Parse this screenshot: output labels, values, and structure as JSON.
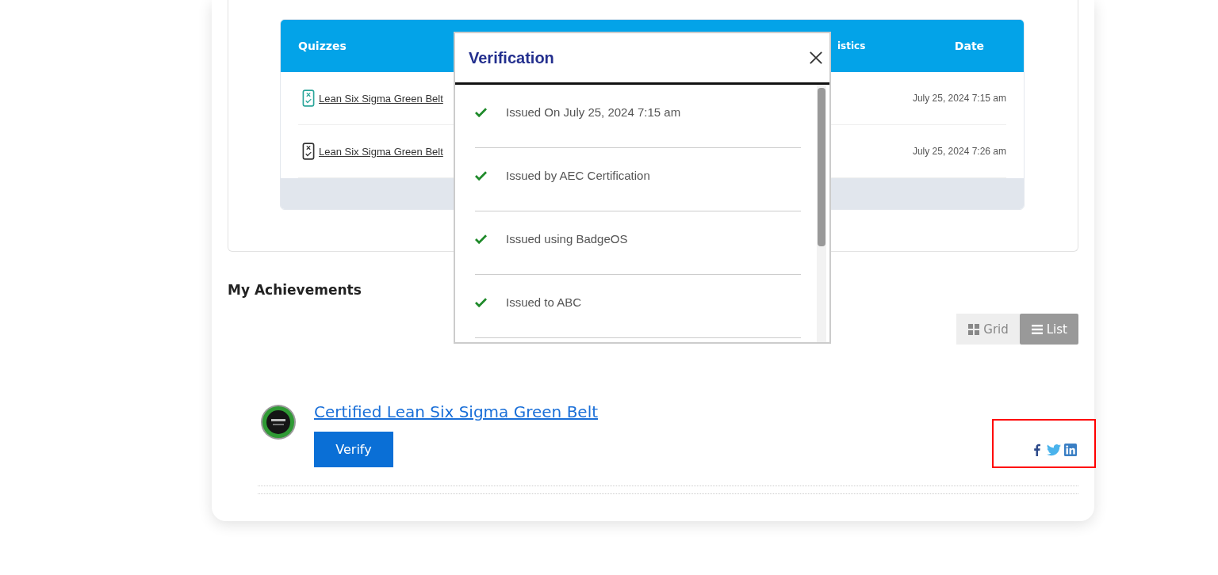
{
  "quiz_table": {
    "columns": [
      "Quizzes",
      "istics",
      "Date"
    ],
    "rows": [
      {
        "quiz": "Lean Six Sigma Green Belt",
        "date": "July 25, 2024 7:15 am",
        "kind": "passed"
      },
      {
        "quiz": "Lean Six Sigma Green Belt",
        "date": "July 25, 2024 7:26 am",
        "kind": "failed"
      }
    ]
  },
  "achievements": {
    "heading": "My Achievements",
    "views": [
      {
        "label": "Grid",
        "kind": "grid",
        "selected": false
      },
      {
        "label": "List",
        "kind": "list",
        "selected": true
      }
    ],
    "items": [
      {
        "title": "Certified Lean Six Sigma Green Belt",
        "button": "Verify"
      }
    ]
  },
  "verification_dialog": {
    "title": "Verification",
    "items": [
      "Issued On July 25, 2024 7:15 am",
      "Issued by AEC Certification",
      "Issued using BadgeOS",
      "Issued to ABC"
    ]
  }
}
